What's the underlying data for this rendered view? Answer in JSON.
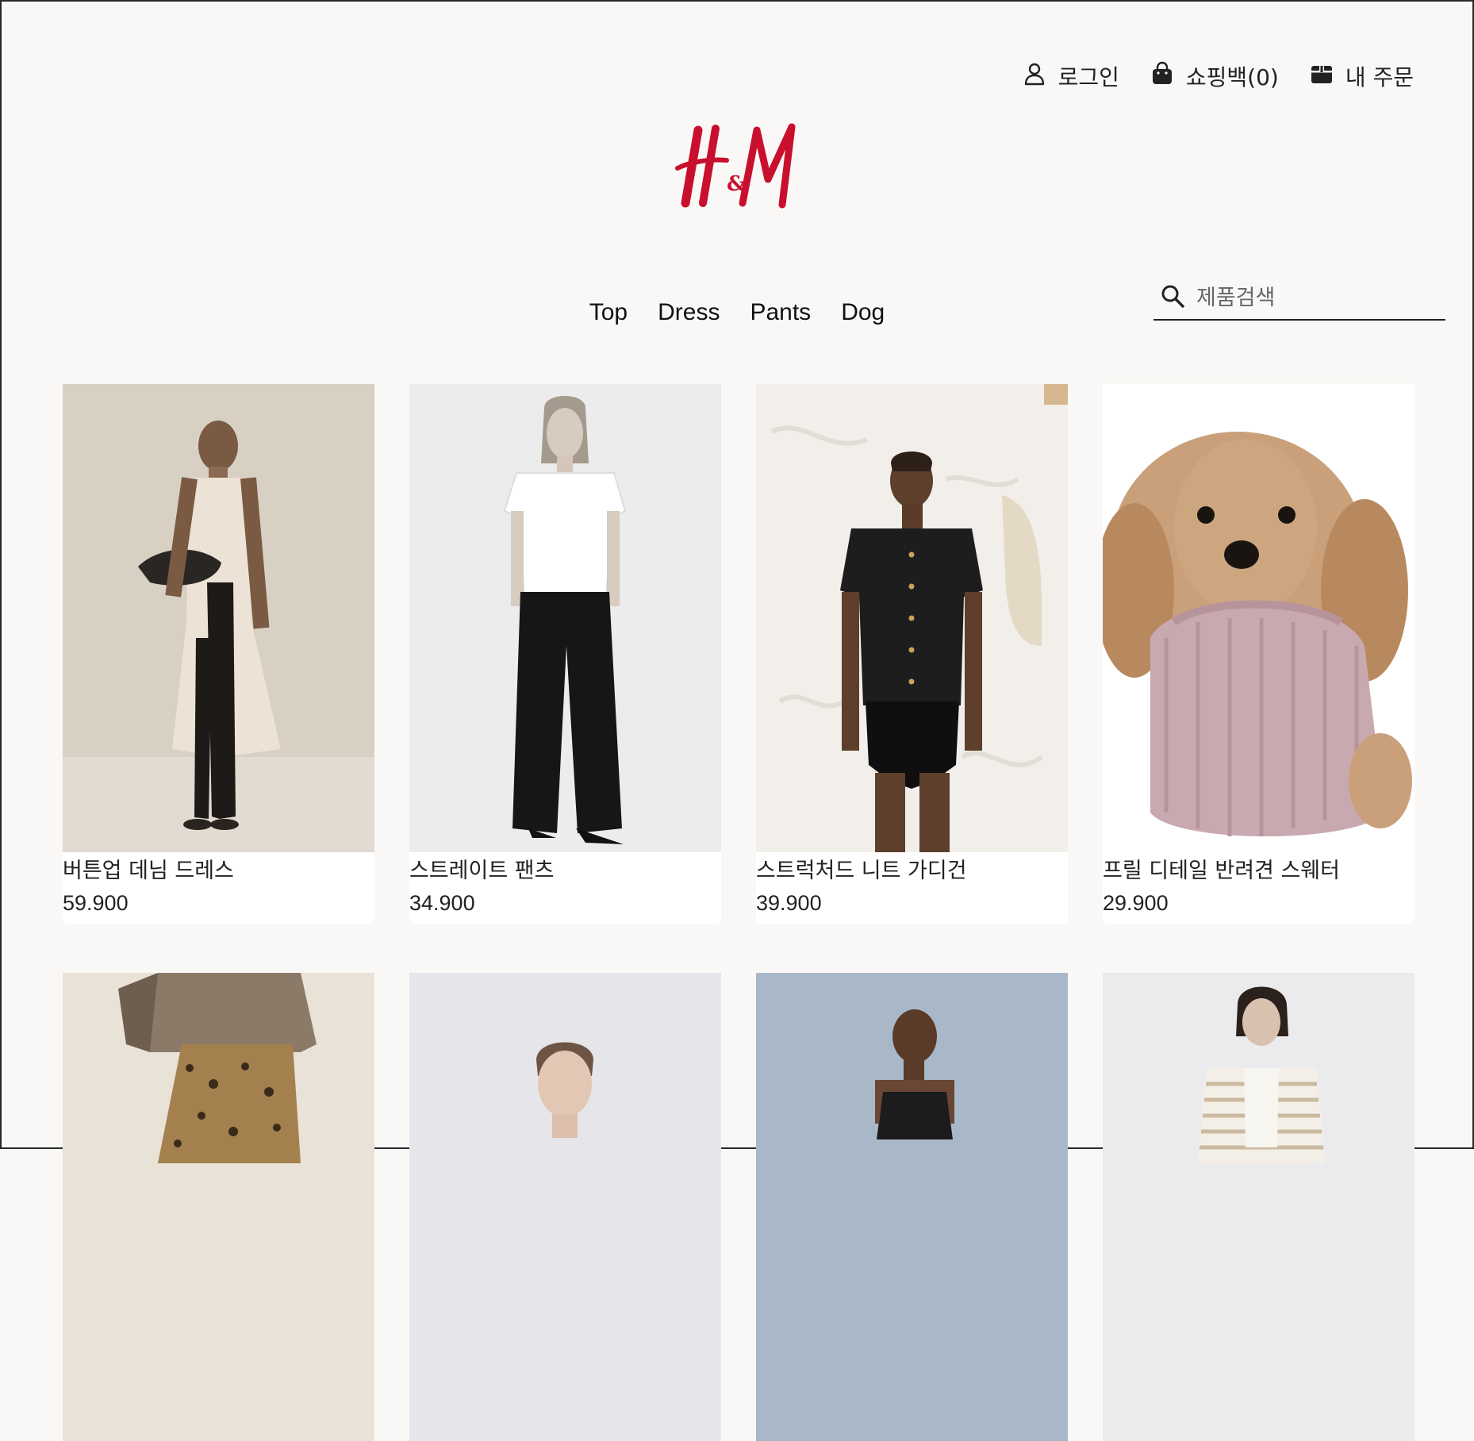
{
  "header": {
    "login_label": "로그인",
    "cart_label": "쇼핑백(0)",
    "orders_label": "내 주문",
    "brand_color": "#c8102e"
  },
  "nav": {
    "items": [
      "Top",
      "Dress",
      "Pants",
      "Dog"
    ]
  },
  "search": {
    "placeholder": "제품검색",
    "icon": "search-icon"
  },
  "products": [
    {
      "name": "버튼업 데님 드레스",
      "price": "59.900",
      "bg": "#d9d0c4"
    },
    {
      "name": "스트레이트 팬츠",
      "price": "34.900",
      "bg": "#ececec"
    },
    {
      "name": "스트럭처드 니트 가디건",
      "price": "39.900",
      "bg": "#efece8"
    },
    {
      "name": "프릴 디테일 반려견 스웨터",
      "price": "29.900",
      "bg": "#ffffff"
    }
  ]
}
